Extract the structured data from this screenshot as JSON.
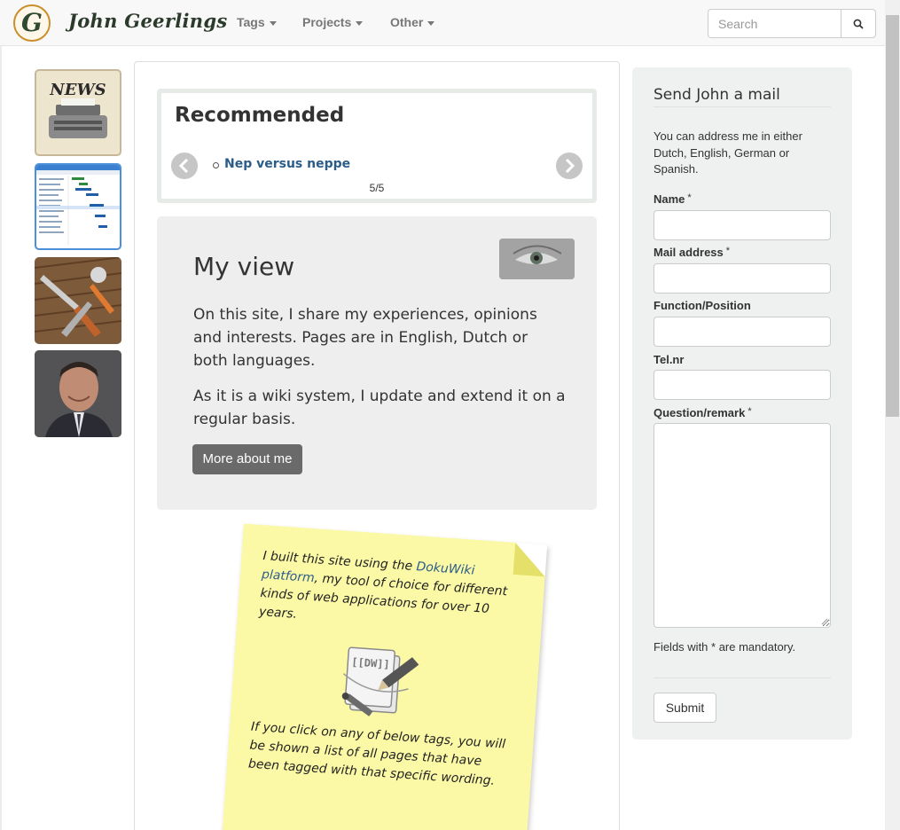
{
  "brand": {
    "logo_letter": "G",
    "name": "John Geerlings"
  },
  "nav": {
    "items": [
      {
        "label": "Tags"
      },
      {
        "label": "Projects"
      },
      {
        "label": "Other"
      }
    ],
    "search_placeholder": "Search"
  },
  "thumbnails": [
    {
      "name": "news-typewriter",
      "text": "NEWS"
    },
    {
      "name": "gantt-chart"
    },
    {
      "name": "tools"
    },
    {
      "name": "man-smiling"
    }
  ],
  "recommended": {
    "title": "Recommended",
    "item": "Nep versus neppe",
    "counter": "5/5"
  },
  "my_view": {
    "title": "My view",
    "paragraph1": "On this site, I share my experiences, opinions and interests. Pages are in English, Dutch or both languages.",
    "paragraph2": "As it is a wiki system, I update and extend it on a regular basis.",
    "button": "More about me"
  },
  "note": {
    "text_before_link": "I built this site using the ",
    "link": "DokuWiki platform",
    "text_after_link": ", my tool of choice for different kinds of web applications for over 10 years.",
    "logo_text": "[[DW]]",
    "text2": "If you click on any of below tags, you will be shown a list of all pages that have been tagged with that specific wording."
  },
  "mail_form": {
    "title": "Send John a mail",
    "intro": "You can address me in either Dutch, English, German or Spanish.",
    "fields": [
      {
        "label": "Name",
        "required": "*"
      },
      {
        "label": "Mail address",
        "required": "*"
      },
      {
        "label": "Function/Position",
        "required": ""
      },
      {
        "label": "Tel.nr",
        "required": ""
      },
      {
        "label": "Question/remark",
        "required": "*"
      }
    ],
    "mandatory_note": "Fields with * are mandatory.",
    "submit": "Submit"
  },
  "colors": {
    "link": "#2a5d8a",
    "panel_bg": "#eef1f0",
    "note_bg": "#fbf9a6",
    "button_dark": "#6a6a6a"
  }
}
